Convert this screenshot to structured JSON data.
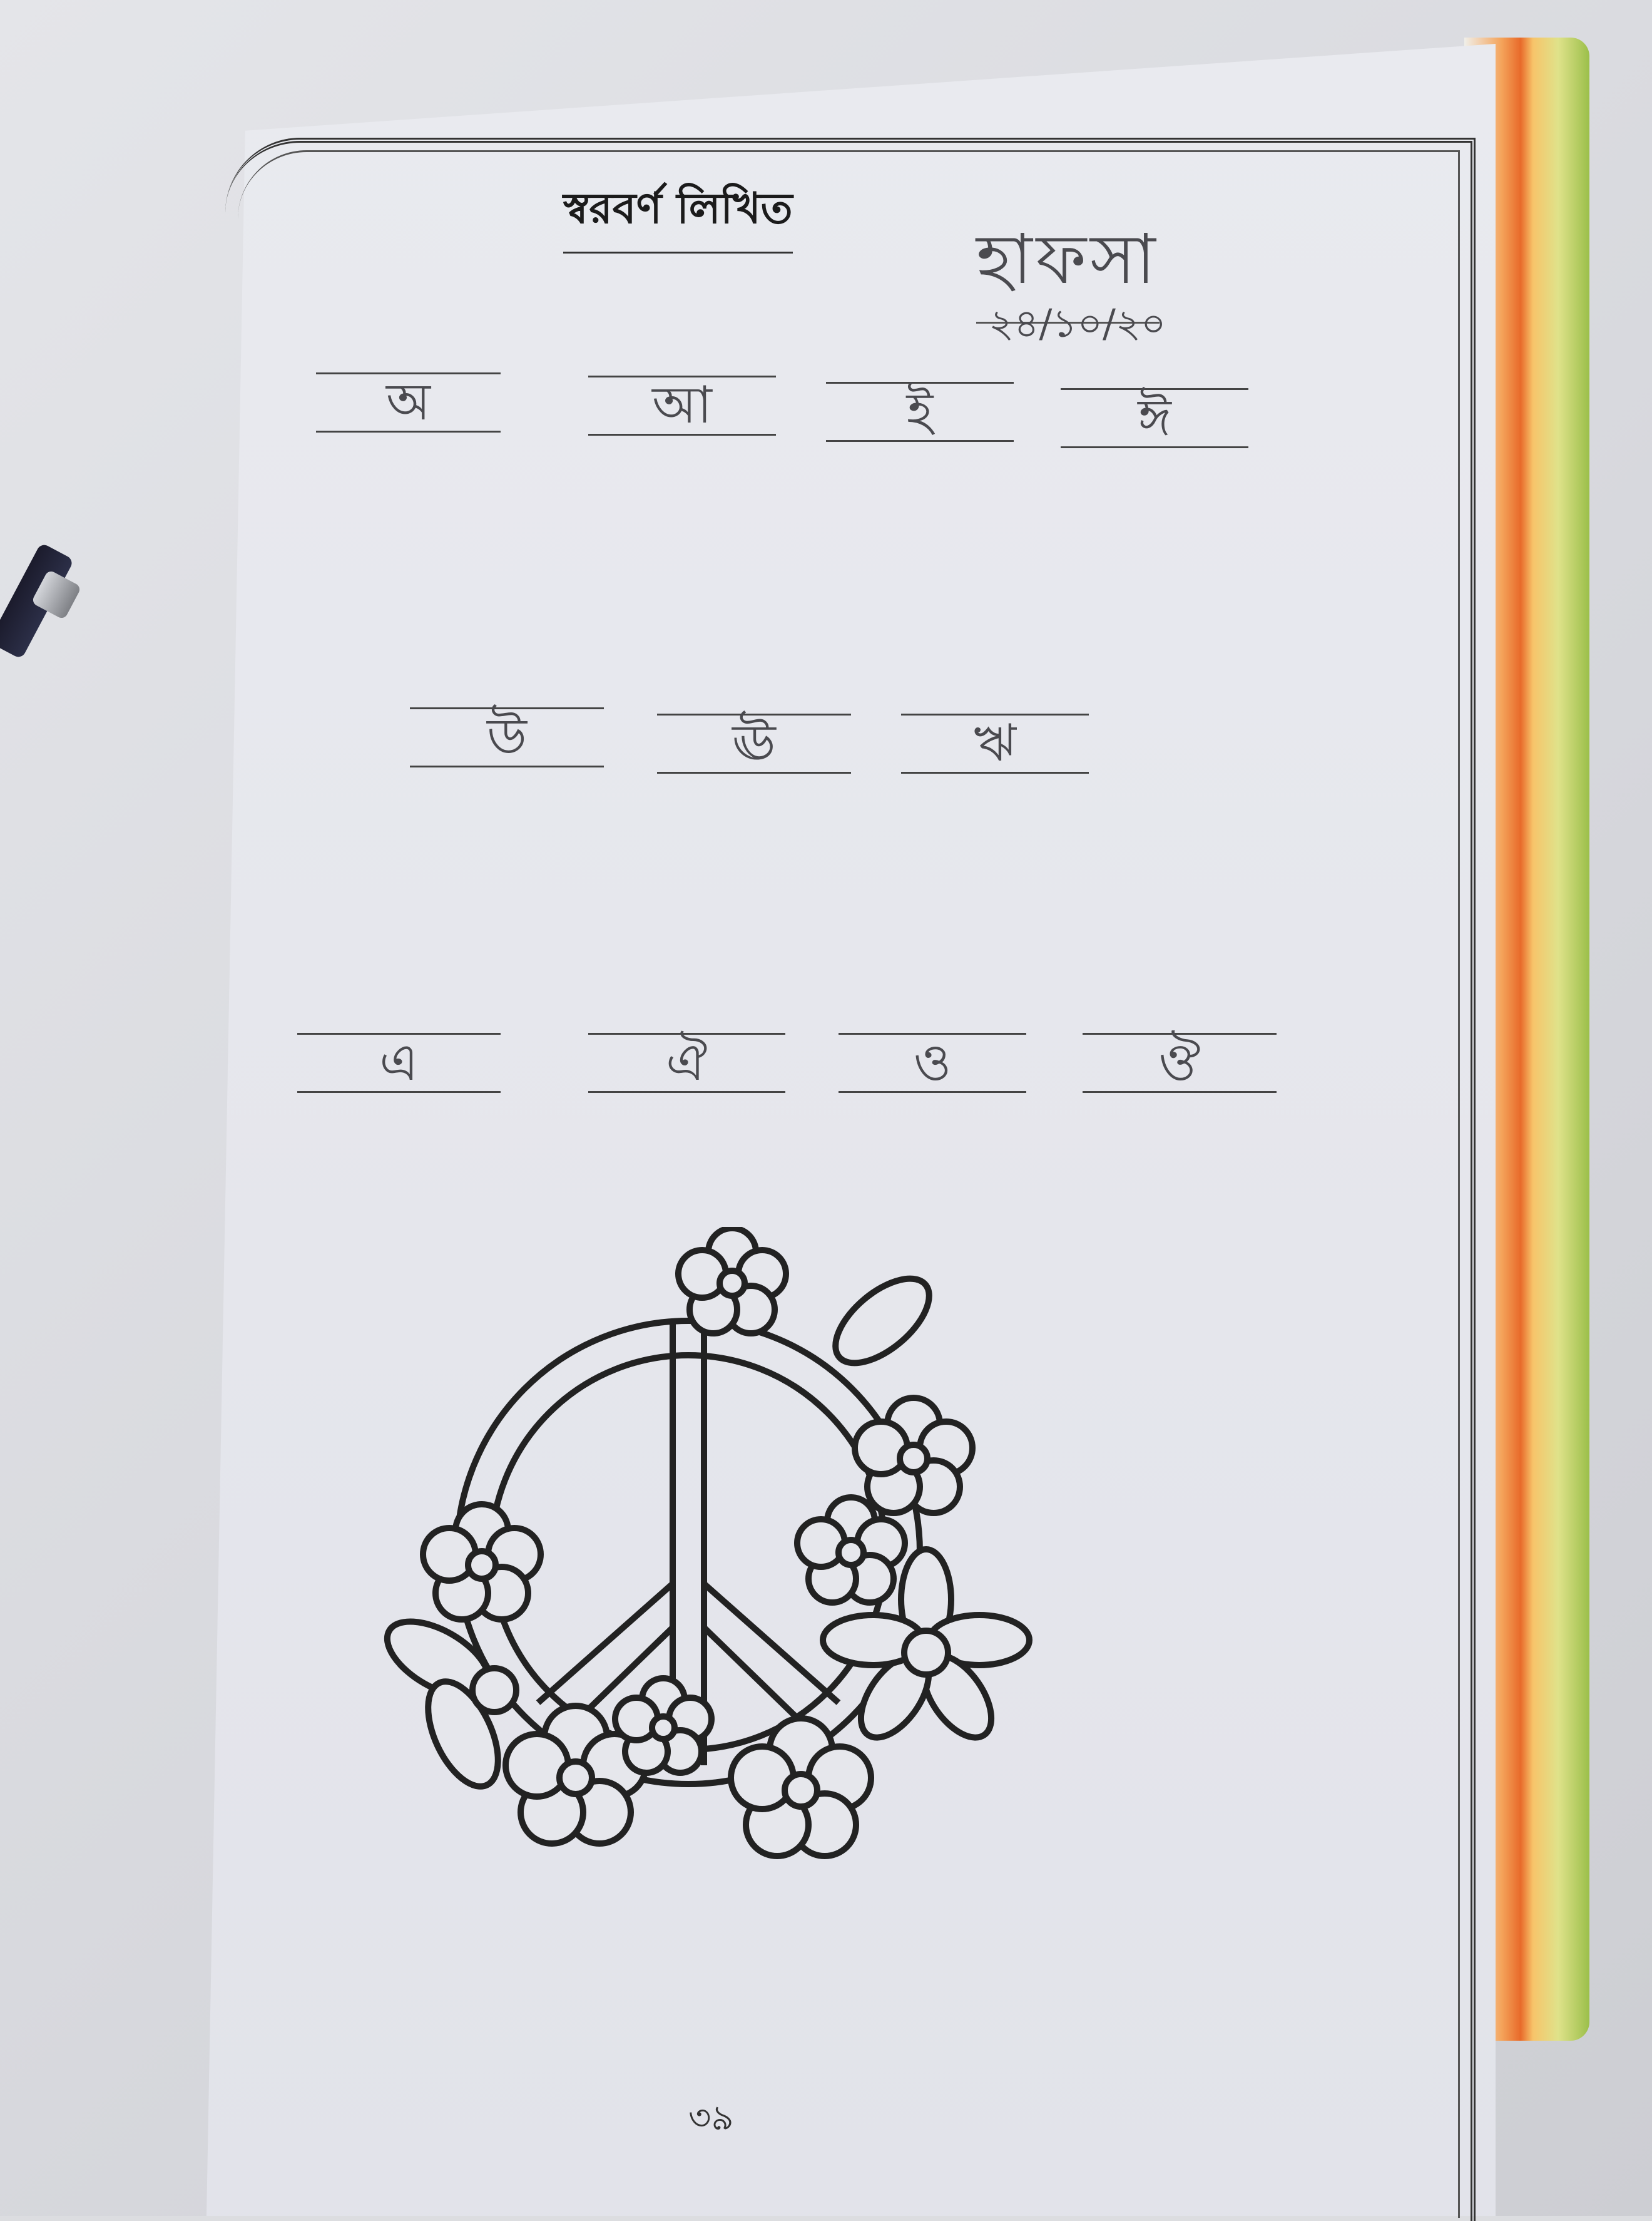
{
  "page_title": "স্বরবর্ণ লিখিত",
  "handwritten_name": "হাফসা",
  "handwritten_date": "২৪/১০/২০",
  "rows": [
    [
      "অ",
      "আ",
      "ই",
      "ঈ"
    ],
    [
      "উ",
      "ঊ",
      "ঋ"
    ],
    [
      "এ",
      "ঐ",
      "ও",
      "ঔ"
    ]
  ],
  "page_number": "৩৯",
  "illustration": "peace-sign-with-flowers"
}
